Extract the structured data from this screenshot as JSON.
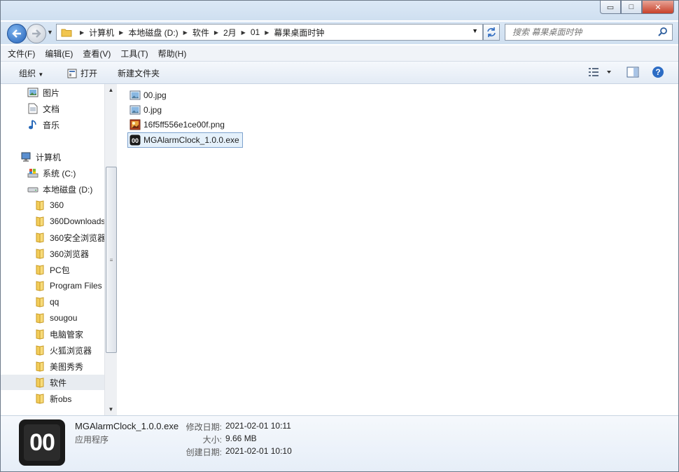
{
  "window": {
    "buttons": {
      "minimize": "▭",
      "maximize": "□",
      "close": "✕"
    }
  },
  "address": {
    "crumbs": [
      "计算机",
      "本地磁盘 (D:)",
      "软件",
      "2月",
      "01",
      "幕果桌面时钟"
    ]
  },
  "search": {
    "placeholder": "搜索 幕果桌面时钟"
  },
  "menu": {
    "items": [
      "文件(F)",
      "编辑(E)",
      "查看(V)",
      "工具(T)",
      "帮助(H)"
    ]
  },
  "toolbar": {
    "organize": "组织",
    "open": "打开",
    "new_folder": "新建文件夹"
  },
  "sidebar": {
    "libraries": [
      {
        "label": "图片",
        "icon": "pictures-icon"
      },
      {
        "label": "文档",
        "icon": "documents-icon"
      },
      {
        "label": "音乐",
        "icon": "music-icon"
      }
    ],
    "computer": {
      "label": "计算机",
      "icon": "computer-icon"
    },
    "drives": [
      {
        "label": "系统 (C:)",
        "icon": "system-drive-icon"
      },
      {
        "label": "本地磁盘 (D:)",
        "icon": "local-disk-icon"
      }
    ],
    "folders": [
      "360",
      "360Downloads",
      "360安全浏览器",
      "360浏览器",
      "PC包",
      "Program Files",
      "qq",
      "sougou",
      "电脑管家",
      "火狐浏览器",
      "美图秀秀",
      "软件",
      "新obs"
    ],
    "selected_folder": "软件"
  },
  "files": [
    {
      "name": "00.jpg",
      "icon": "image-file-icon"
    },
    {
      "name": "0.jpg",
      "icon": "image-file-icon"
    },
    {
      "name": "16f5ff556e1ce00f.png",
      "icon": "png-file-icon"
    },
    {
      "name": "MGAlarmClock_1.0.0.exe",
      "icon": "app-icon",
      "selected": true
    }
  ],
  "details": {
    "icon_text": "00",
    "filename": "MGAlarmClock_1.0.0.exe",
    "type": "应用程序",
    "modified_label": "修改日期:",
    "modified": "2021-02-01 10:11",
    "size_label": "大小:",
    "size": "9.66 MB",
    "created_label": "创建日期:",
    "created": "2021-02-01 10:10"
  }
}
